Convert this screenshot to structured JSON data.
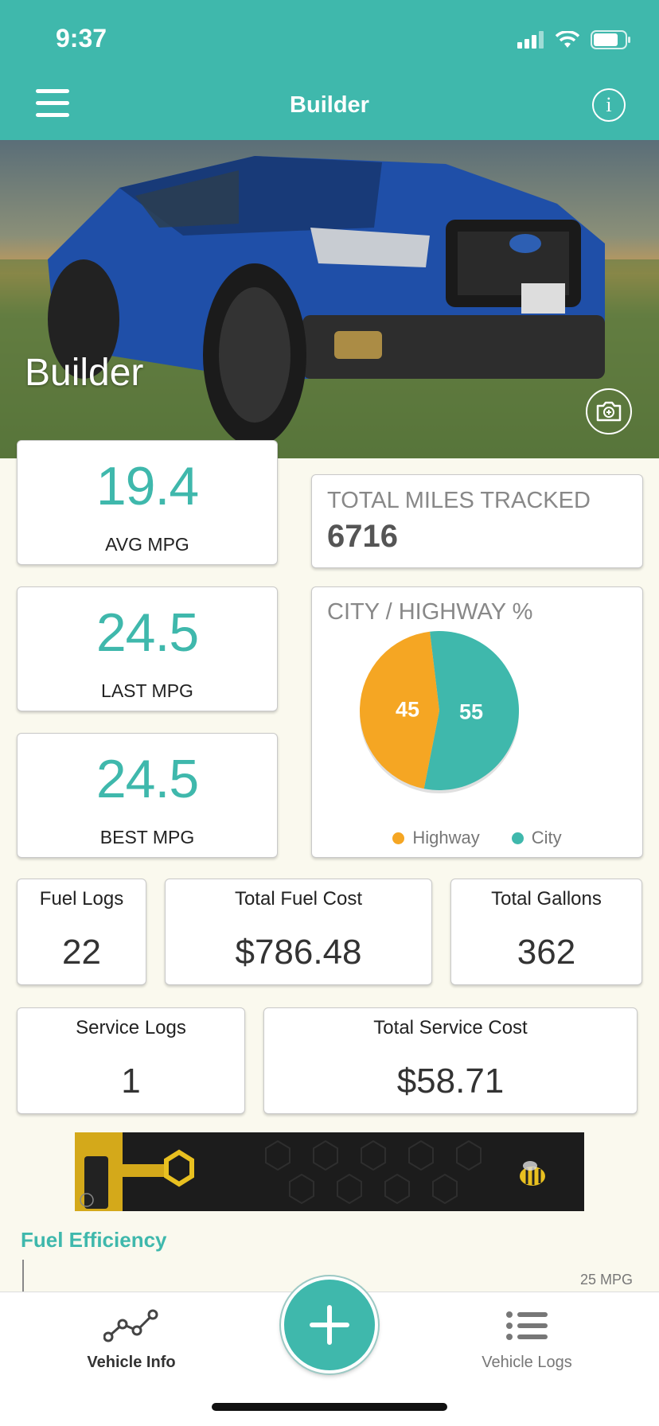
{
  "status_bar": {
    "time": "9:37"
  },
  "header": {
    "title": "Builder",
    "info_label": "i"
  },
  "hero": {
    "vehicle_name": "Builder"
  },
  "metrics": {
    "avg_mpg": {
      "value": "19.4",
      "label": "AVG MPG"
    },
    "last_mpg": {
      "value": "24.5",
      "label": "LAST MPG"
    },
    "best_mpg": {
      "value": "24.5",
      "label": "BEST MPG"
    }
  },
  "total_miles": {
    "title": "TOTAL MILES TRACKED",
    "value": "6716"
  },
  "city_highway": {
    "title": "CITY / HIGHWAY %",
    "legend": [
      {
        "label": "Highway",
        "color": "#f5a623"
      },
      {
        "label": "City",
        "color": "#3fb8ac"
      }
    ]
  },
  "chart_data": {
    "type": "pie",
    "title": "CITY / HIGHWAY %",
    "categories": [
      "Highway",
      "City"
    ],
    "values": [
      45,
      55
    ],
    "colors": [
      "#f5a623",
      "#3fb8ac"
    ],
    "legend": "bottom"
  },
  "stats_row1": {
    "fuel_logs": {
      "title": "Fuel Logs",
      "value": "22"
    },
    "total_fuel_cost": {
      "title": "Total Fuel Cost",
      "value": "$786.48"
    },
    "total_gallons": {
      "title": "Total Gallons",
      "value": "362"
    }
  },
  "stats_row2": {
    "service_logs": {
      "title": "Service Logs",
      "value": "1"
    },
    "total_service_cost": {
      "title": "Total Service Cost",
      "value": "$58.71"
    }
  },
  "fuel_efficiency": {
    "title": "Fuel Efficiency",
    "tick_label": "25 MPG"
  },
  "tabbar": {
    "vehicle_info": "Vehicle Info",
    "vehicle_logs": "Vehicle Logs"
  },
  "colors": {
    "accent": "#3fb8ac",
    "highway": "#f5a623",
    "background": "#faf9ee"
  }
}
